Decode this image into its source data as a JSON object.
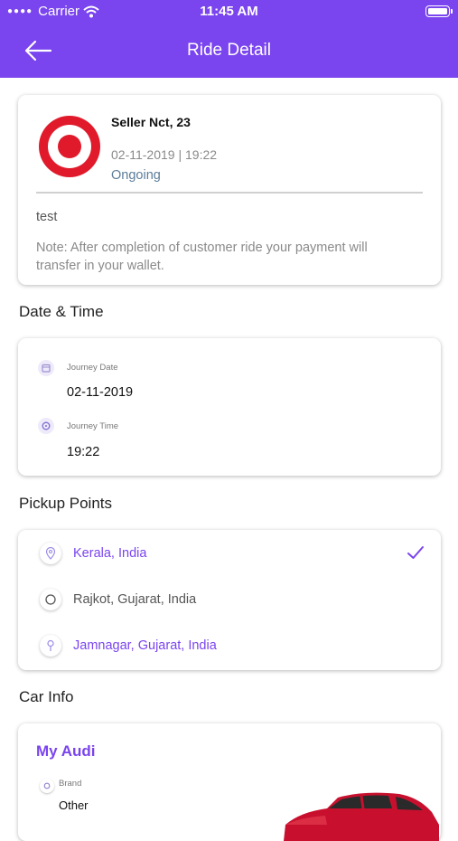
{
  "status_bar": {
    "carrier": "Carrier",
    "time": "11:45 AM"
  },
  "nav": {
    "title": "Ride Detail"
  },
  "ride": {
    "seller": "Seller Nct, 23",
    "datetime": "02-11-2019 | 19:22",
    "status": "Ongoing",
    "note_title": "test",
    "note": "Note: After completion of customer ride your payment will transfer in your wallet."
  },
  "date_time": {
    "section_title": "Date & Time",
    "journey_date_label": "Journey Date",
    "journey_date": "02-11-2019",
    "journey_time_label": "Journey Time",
    "journey_time": "19:22"
  },
  "pickup": {
    "section_title": "Pickup Points",
    "points": [
      {
        "name": "Kerala, India",
        "selected": true
      },
      {
        "name": "Rajkot, Gujarat, India",
        "selected": false
      },
      {
        "name": "Jamnagar, Gujarat, India",
        "selected": false
      }
    ]
  },
  "car": {
    "section_title": "Car Info",
    "name": "My Audi",
    "brand_label": "Brand",
    "brand": "Other"
  },
  "colors": {
    "accent": "#7a44ee",
    "logo_red": "#e01a2b",
    "status": "#5d7d9a"
  }
}
